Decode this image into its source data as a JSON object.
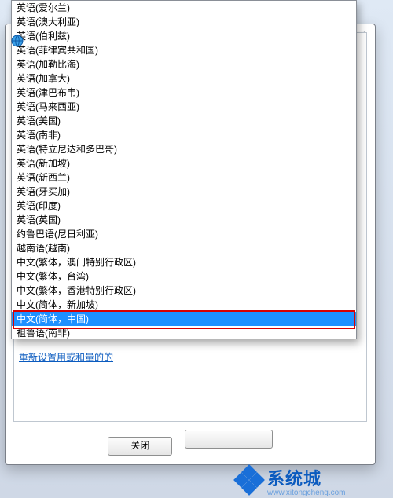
{
  "dialog": {
    "close_glyph": "✕",
    "buttons": {
      "close_label": "关闭",
      "second_label": ""
    }
  },
  "dropdown": {
    "selected_index": 22,
    "items": [
      "英语(爱尔兰)",
      "英语(澳大利亚)",
      "英语(伯利兹)",
      "英语(菲律宾共和国)",
      "英语(加勒比海)",
      "英语(加拿大)",
      "英语(津巴布韦)",
      "英语(马来西亚)",
      "英语(美国)",
      "英语(南非)",
      "英语(特立尼达和多巴哥)",
      "英语(新加坡)",
      "英语(新西兰)",
      "英语(牙买加)",
      "英语(印度)",
      "英语(英国)",
      "约鲁巴语(尼日利亚)",
      "越南语(越南)",
      "中文(繁体，澳门特别行政区)",
      "中文(繁体，台湾)",
      "中文(繁体，香港特别行政区)",
      "中文(简体，新加坡)",
      "中文(简体，中国)",
      "祖鲁语(南非)"
    ]
  },
  "extra": {
    "link_text": "重新设置用或和量的的"
  },
  "watermark": {
    "brand": "系统城",
    "url": "www.xitongcheng.com"
  },
  "globe_icon": {
    "name": "globe-icon"
  }
}
